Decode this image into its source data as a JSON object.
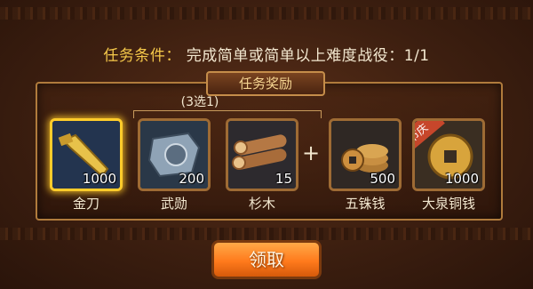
{
  "mission": {
    "condition_label": "任务条件：",
    "condition_text": "完成简单或简单以上难度战役：1/1"
  },
  "reward_panel": {
    "title": "任务奖励",
    "choose_hint": "(3选1)",
    "choice_items": [
      {
        "name": "金刀",
        "count": "1000",
        "icon": "golden-blade-icon"
      },
      {
        "name": "武勋",
        "count": "200",
        "icon": "military-merit-icon"
      },
      {
        "name": "杉木",
        "count": "15",
        "icon": "fir-wood-icon"
      }
    ],
    "plus_sign": "+",
    "fixed_items": [
      {
        "name": "五铢钱",
        "count": "500",
        "icon": "wuzhu-coins-icon"
      },
      {
        "name": "大泉铜钱",
        "count": "1000",
        "icon": "daquan-copper-coin-icon",
        "tag": "节庆"
      }
    ]
  },
  "actions": {
    "claim_label": "领取"
  },
  "colors": {
    "accent_gold": "#f5c84a",
    "selected_border": "#ffcc2a",
    "button_orange": "#ff7a1c"
  }
}
